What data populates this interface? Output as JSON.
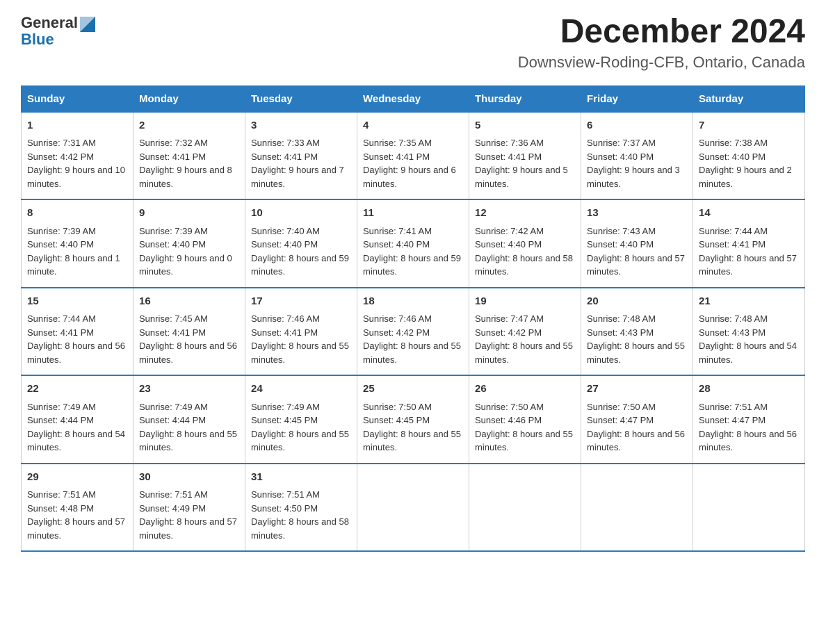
{
  "header": {
    "logo_line1": "General",
    "logo_line2": "Blue",
    "month": "December 2024",
    "location": "Downsview-Roding-CFB, Ontario, Canada"
  },
  "weekdays": [
    "Sunday",
    "Monday",
    "Tuesday",
    "Wednesday",
    "Thursday",
    "Friday",
    "Saturday"
  ],
  "weeks": [
    [
      {
        "day": "1",
        "sunrise": "7:31 AM",
        "sunset": "4:42 PM",
        "daylight": "9 hours and 10 minutes."
      },
      {
        "day": "2",
        "sunrise": "7:32 AM",
        "sunset": "4:41 PM",
        "daylight": "9 hours and 8 minutes."
      },
      {
        "day": "3",
        "sunrise": "7:33 AM",
        "sunset": "4:41 PM",
        "daylight": "9 hours and 7 minutes."
      },
      {
        "day": "4",
        "sunrise": "7:35 AM",
        "sunset": "4:41 PM",
        "daylight": "9 hours and 6 minutes."
      },
      {
        "day": "5",
        "sunrise": "7:36 AM",
        "sunset": "4:41 PM",
        "daylight": "9 hours and 5 minutes."
      },
      {
        "day": "6",
        "sunrise": "7:37 AM",
        "sunset": "4:40 PM",
        "daylight": "9 hours and 3 minutes."
      },
      {
        "day": "7",
        "sunrise": "7:38 AM",
        "sunset": "4:40 PM",
        "daylight": "9 hours and 2 minutes."
      }
    ],
    [
      {
        "day": "8",
        "sunrise": "7:39 AM",
        "sunset": "4:40 PM",
        "daylight": "8 hours and 1 minute."
      },
      {
        "day": "9",
        "sunrise": "7:39 AM",
        "sunset": "4:40 PM",
        "daylight": "9 hours and 0 minutes."
      },
      {
        "day": "10",
        "sunrise": "7:40 AM",
        "sunset": "4:40 PM",
        "daylight": "8 hours and 59 minutes."
      },
      {
        "day": "11",
        "sunrise": "7:41 AM",
        "sunset": "4:40 PM",
        "daylight": "8 hours and 59 minutes."
      },
      {
        "day": "12",
        "sunrise": "7:42 AM",
        "sunset": "4:40 PM",
        "daylight": "8 hours and 58 minutes."
      },
      {
        "day": "13",
        "sunrise": "7:43 AM",
        "sunset": "4:40 PM",
        "daylight": "8 hours and 57 minutes."
      },
      {
        "day": "14",
        "sunrise": "7:44 AM",
        "sunset": "4:41 PM",
        "daylight": "8 hours and 57 minutes."
      }
    ],
    [
      {
        "day": "15",
        "sunrise": "7:44 AM",
        "sunset": "4:41 PM",
        "daylight": "8 hours and 56 minutes."
      },
      {
        "day": "16",
        "sunrise": "7:45 AM",
        "sunset": "4:41 PM",
        "daylight": "8 hours and 56 minutes."
      },
      {
        "day": "17",
        "sunrise": "7:46 AM",
        "sunset": "4:41 PM",
        "daylight": "8 hours and 55 minutes."
      },
      {
        "day": "18",
        "sunrise": "7:46 AM",
        "sunset": "4:42 PM",
        "daylight": "8 hours and 55 minutes."
      },
      {
        "day": "19",
        "sunrise": "7:47 AM",
        "sunset": "4:42 PM",
        "daylight": "8 hours and 55 minutes."
      },
      {
        "day": "20",
        "sunrise": "7:48 AM",
        "sunset": "4:43 PM",
        "daylight": "8 hours and 55 minutes."
      },
      {
        "day": "21",
        "sunrise": "7:48 AM",
        "sunset": "4:43 PM",
        "daylight": "8 hours and 54 minutes."
      }
    ],
    [
      {
        "day": "22",
        "sunrise": "7:49 AM",
        "sunset": "4:44 PM",
        "daylight": "8 hours and 54 minutes."
      },
      {
        "day": "23",
        "sunrise": "7:49 AM",
        "sunset": "4:44 PM",
        "daylight": "8 hours and 55 minutes."
      },
      {
        "day": "24",
        "sunrise": "7:49 AM",
        "sunset": "4:45 PM",
        "daylight": "8 hours and 55 minutes."
      },
      {
        "day": "25",
        "sunrise": "7:50 AM",
        "sunset": "4:45 PM",
        "daylight": "8 hours and 55 minutes."
      },
      {
        "day": "26",
        "sunrise": "7:50 AM",
        "sunset": "4:46 PM",
        "daylight": "8 hours and 55 minutes."
      },
      {
        "day": "27",
        "sunrise": "7:50 AM",
        "sunset": "4:47 PM",
        "daylight": "8 hours and 56 minutes."
      },
      {
        "day": "28",
        "sunrise": "7:51 AM",
        "sunset": "4:47 PM",
        "daylight": "8 hours and 56 minutes."
      }
    ],
    [
      {
        "day": "29",
        "sunrise": "7:51 AM",
        "sunset": "4:48 PM",
        "daylight": "8 hours and 57 minutes."
      },
      {
        "day": "30",
        "sunrise": "7:51 AM",
        "sunset": "4:49 PM",
        "daylight": "8 hours and 57 minutes."
      },
      {
        "day": "31",
        "sunrise": "7:51 AM",
        "sunset": "4:50 PM",
        "daylight": "8 hours and 58 minutes."
      },
      null,
      null,
      null,
      null
    ]
  ]
}
